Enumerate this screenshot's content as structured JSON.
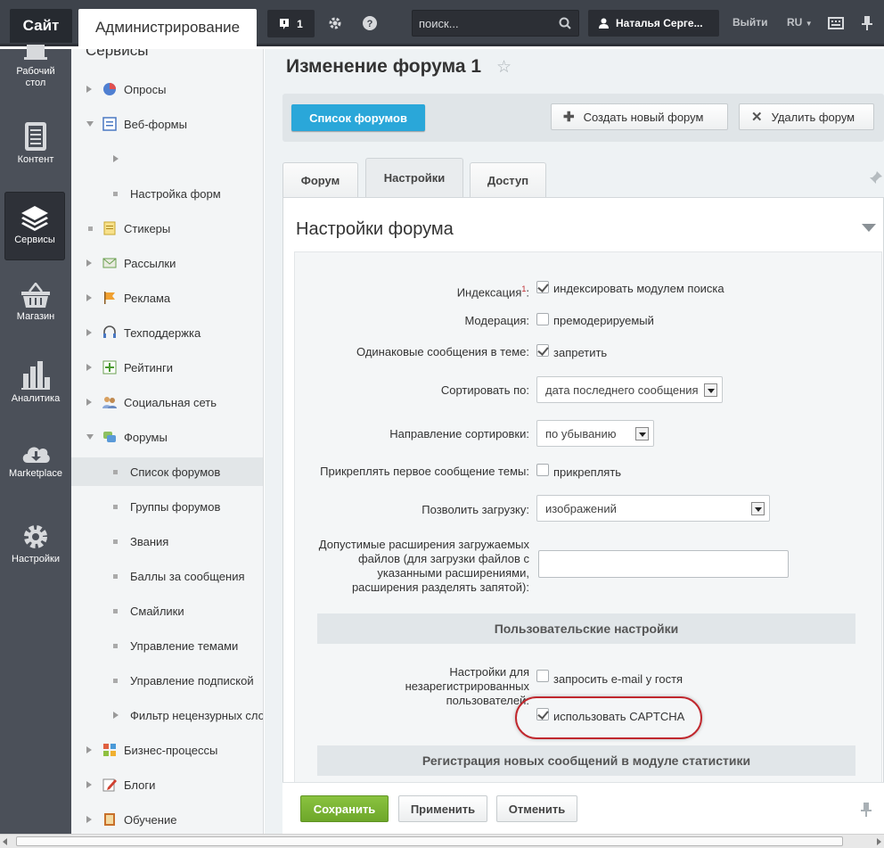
{
  "topbar": {
    "site_label": "Сайт",
    "admin_label": "Администрирование",
    "notifications_count": "1",
    "search_placeholder": "поиск...",
    "user_name": "Наталья Серге...",
    "logout_label": "Выйти",
    "language": "RU"
  },
  "iconbar": {
    "items": [
      {
        "label": "Рабочий стол",
        "icon": "desktop-icon"
      },
      {
        "label": "Контент",
        "icon": "document-icon"
      },
      {
        "label": "Сервисы",
        "icon": "layers-icon",
        "active": true
      },
      {
        "label": "Магазин",
        "icon": "basket-icon"
      },
      {
        "label": "Аналитика",
        "icon": "bar-chart-icon"
      },
      {
        "label": "Marketplace",
        "icon": "cloud-download-icon"
      },
      {
        "label": "Настройки",
        "icon": "gear-icon"
      }
    ]
  },
  "menu": {
    "partial_header": "Сервисы",
    "items": [
      {
        "label": "Опросы"
      },
      {
        "label": "Веб-формы"
      },
      {
        "label": ""
      },
      {
        "label": "Настройка форм"
      },
      {
        "label": "Стикеры"
      },
      {
        "label": "Рассылки"
      },
      {
        "label": "Реклама"
      },
      {
        "label": "Техподдержка"
      },
      {
        "label": "Рейтинги"
      },
      {
        "label": "Социальная сеть"
      },
      {
        "label": "Форумы"
      },
      {
        "label": "Список форумов"
      },
      {
        "label": "Группы форумов"
      },
      {
        "label": "Звания"
      },
      {
        "label": "Баллы за сообщения"
      },
      {
        "label": "Смайлики"
      },
      {
        "label": "Управление темами"
      },
      {
        "label": "Управление подпиской"
      },
      {
        "label": "Фильтр нецензурных слов"
      },
      {
        "label": "Бизнес-процессы"
      },
      {
        "label": "Блоги"
      },
      {
        "label": "Обучение"
      }
    ]
  },
  "page": {
    "title": "Изменение форума 1",
    "buttons": {
      "list": "Список форумов",
      "create": "Создать новый форум",
      "delete": "Удалить форум"
    },
    "tabs": [
      "Форум",
      "Настройки",
      "Доступ"
    ],
    "active_tab": "Настройки"
  },
  "panel": {
    "title": "Настройки форума",
    "indexing_label": "Индексация",
    "indexing_sup": "1",
    "indexing_cb": "индексировать модулем поиска",
    "moderation_label": "Модерация:",
    "moderation_cb": "премодерируемый",
    "duplicates_label": "Одинаковые сообщения в теме:",
    "duplicates_cb": "запретить",
    "sort_label": "Сортировать по:",
    "sort_value": "дата последнего сообщения",
    "sortdir_label": "Направление сортировки:",
    "sortdir_value": "по убыванию",
    "pin_label": "Прикреплять первое сообщение темы:",
    "pin_cb": "прикреплять",
    "upload_label": "Позволить загрузку:",
    "upload_value": "изображений",
    "ext_label": "Допустимые расширения загружаемых файлов (для загрузки файлов с указанными расширениями, расширения разделять запятой):",
    "ext_value": "",
    "user_section": "Пользовательские настройки",
    "guest_label": "Настройки для незарегистрированных пользователей:",
    "guest_email_cb": "запросить e-mail у гостя",
    "captcha_cb": "использовать CAPTCHA",
    "stats_section": "Регистрация новых сообщений в модуле статистики"
  },
  "bottom": {
    "save": "Сохранить",
    "apply": "Применить",
    "cancel": "Отменить"
  },
  "colors": {
    "accent_blue": "#2aa7d9",
    "save_green": "#7bb535",
    "highlight_red": "#c0282e"
  }
}
